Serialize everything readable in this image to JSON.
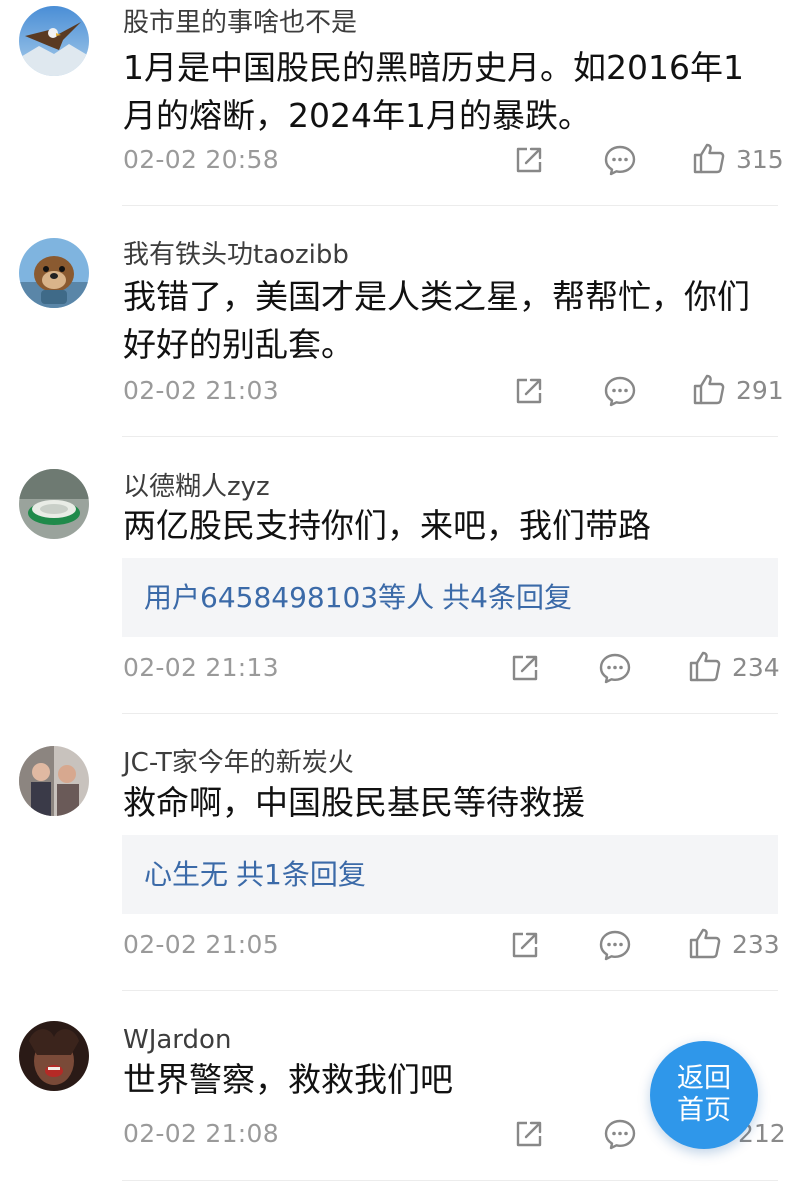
{
  "comments": [
    {
      "username": "股市里的事啥也不是",
      "body": "1月是中国股民的黑暗历史月。如2016年1月的熔断，2024年1月的暴跌。",
      "time": "02-02 20:58",
      "likes": "315",
      "avatar_icon": "eagle-avatar"
    },
    {
      "username": "我有铁头功taozibb",
      "body": "我错了，美国才是人类之星，帮帮忙，你们好好的别乱套。",
      "time": "02-02 21:03",
      "likes": "291",
      "avatar_icon": "otter-avatar"
    },
    {
      "username": "以德糊人zyz",
      "body": "两亿股民支持你们，来吧，我们带路",
      "reply": {
        "users": "用户6458498103等人",
        "count": "共4条回复"
      },
      "time": "02-02 21:13",
      "likes": "234",
      "avatar_icon": "object-avatar"
    },
    {
      "username": "JC-T家今年的新炭火",
      "body": "救命啊，中国股民基民等待救援",
      "reply": {
        "users": "心生无",
        "count": "共1条回复"
      },
      "time": "02-02 21:05",
      "likes": "233",
      "avatar_icon": "people-avatar"
    },
    {
      "username": "WJardon",
      "body": "世界警察，救救我们吧",
      "time": "02-02 21:08",
      "likes": "212",
      "avatar_icon": "face-avatar"
    }
  ],
  "floating_button": {
    "line1": "返回",
    "line2": "首页"
  },
  "colors": {
    "accent": "#2f97ea",
    "reply_link": "#3b6aa8",
    "meta_text": "#9a9a9a"
  },
  "icons": {
    "share": "share-icon",
    "comment": "comment-icon",
    "like": "thumbs-up-icon"
  }
}
